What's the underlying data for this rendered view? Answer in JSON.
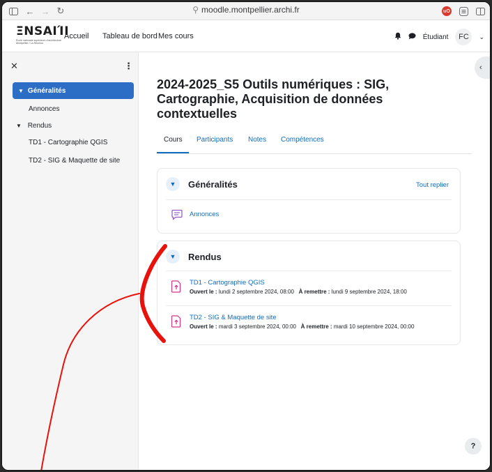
{
  "browser": {
    "url": "moodle.montpellier.archi.fr",
    "ext_label": "uO"
  },
  "navbar": {
    "logo_main": "ΞNSAΙΊΙ",
    "logo_sub": "École nationale supérieure d'architecture Montpellier / La Réunion",
    "links": [
      "Accueil",
      "Tableau de bord",
      "Mes cours"
    ],
    "role": "Étudiant",
    "avatar_initials": "FC"
  },
  "drawer": {
    "items": [
      {
        "label": "Généralités",
        "active": true
      },
      {
        "label": "Annonces"
      },
      {
        "label": "Rendus"
      },
      {
        "label": "TD1 - Cartographie QGIS"
      },
      {
        "label": "TD2 - SIG & Maquette de site"
      }
    ]
  },
  "course": {
    "title": "2024-2025_S5 Outils numériques : SIG, Cartographie, Acquisition de données contextuelles",
    "tabs": [
      "Cours",
      "Participants",
      "Notes",
      "Compétences"
    ]
  },
  "sections": {
    "general": {
      "title": "Généralités",
      "collapse_all": "Tout replier",
      "activity": "Annonces"
    },
    "rendus": {
      "title": "Rendus",
      "opened_label": "Ouvert le :",
      "due_label": "À remettre :",
      "activities": [
        {
          "name": "TD1 - Cartographie QGIS",
          "opened": "lundi 2 septembre 2024, 08:00",
          "due": "lundi 9 septembre 2024, 18:00"
        },
        {
          "name": "TD2 - SIG & Maquette de site",
          "opened": "mardi 3 septembre 2024, 00:00",
          "due": "mardi 10 septembre 2024, 00:00"
        }
      ]
    }
  },
  "help_label": "?",
  "colors": {
    "accent": "#0f6cbf",
    "drawer_active": "#2c6ec5",
    "annotation": "#e8120c"
  }
}
